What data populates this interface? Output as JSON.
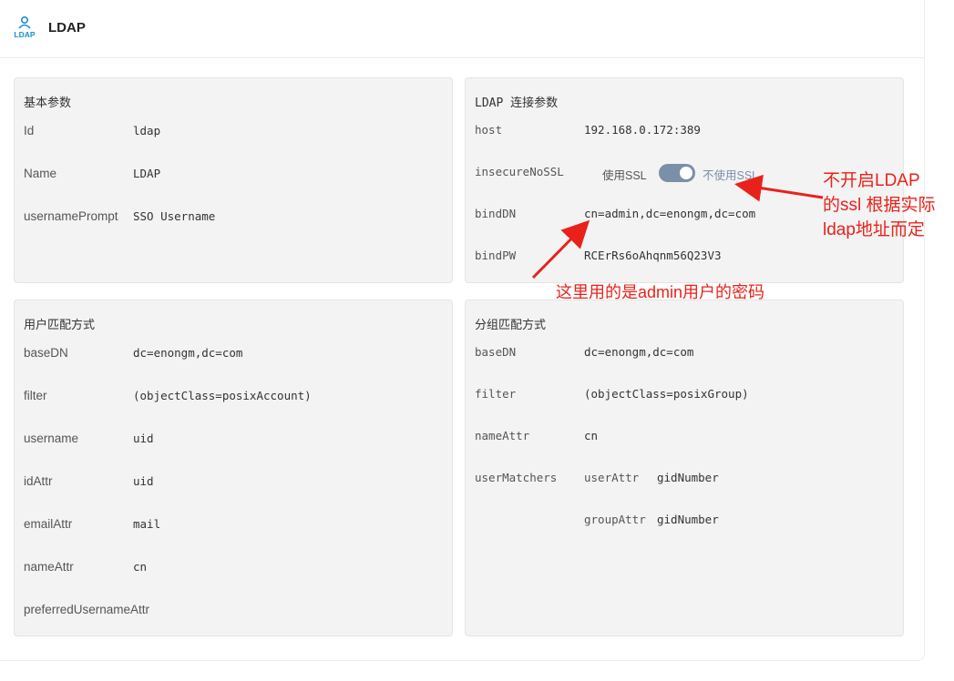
{
  "header": {
    "title": "LDAP",
    "logo_label": "LDAP"
  },
  "basic": {
    "title": "基本参数",
    "rows": [
      {
        "key": "Id",
        "value": "ldap"
      },
      {
        "key": "Name",
        "value": "LDAP"
      },
      {
        "key": "usernamePrompt",
        "value": "SSO Username"
      }
    ]
  },
  "connection": {
    "title": "LDAP 连接参数",
    "host": {
      "key": "host",
      "value": "192.168.0.172:389"
    },
    "insecure": {
      "key": "insecureNoSSL",
      "on_label": "使用SSL",
      "off_label": "不使用SSL",
      "enabled": true
    },
    "bindDN": {
      "key": "bindDN",
      "value": "cn=admin,dc=enongm,dc=com"
    },
    "bindPW": {
      "key": "bindPW",
      "value": "RCErRs6oAhqnm56Q23V3"
    }
  },
  "user_match": {
    "title": "用户匹配方式",
    "rows": [
      {
        "key": "baseDN",
        "value": "dc=enongm,dc=com"
      },
      {
        "key": "filter",
        "value": "(objectClass=posixAccount)"
      },
      {
        "key": "username",
        "value": "uid"
      },
      {
        "key": "idAttr",
        "value": "uid"
      },
      {
        "key": "emailAttr",
        "value": "mail"
      },
      {
        "key": "nameAttr",
        "value": "cn"
      },
      {
        "key": "preferredUsernameAttr",
        "value": ""
      }
    ]
  },
  "group_match": {
    "title": "分组匹配方式",
    "rows": [
      {
        "key": "baseDN",
        "value": "dc=enongm,dc=com"
      },
      {
        "key": "filter",
        "value": "(objectClass=posixGroup)"
      },
      {
        "key": "nameAttr",
        "value": "cn"
      }
    ],
    "userMatchers": {
      "key": "userMatchers",
      "userAttr_key": "userAttr",
      "userAttr_value": "gidNumber",
      "groupAttr_key": "groupAttr",
      "groupAttr_value": "gidNumber"
    }
  },
  "annotations": {
    "ssl_note_line1": "不开启LDAP",
    "ssl_note_line2": "的ssl 根据实际",
    "ssl_note_line3": "ldap地址而定",
    "bind_note": "这里用的是admin用户的密码",
    "color": "#e8221b"
  },
  "colors": {
    "accent": "#7c8fa8",
    "card_bg": "#f3f3f3",
    "logo_blue": "#1a8fd8"
  }
}
